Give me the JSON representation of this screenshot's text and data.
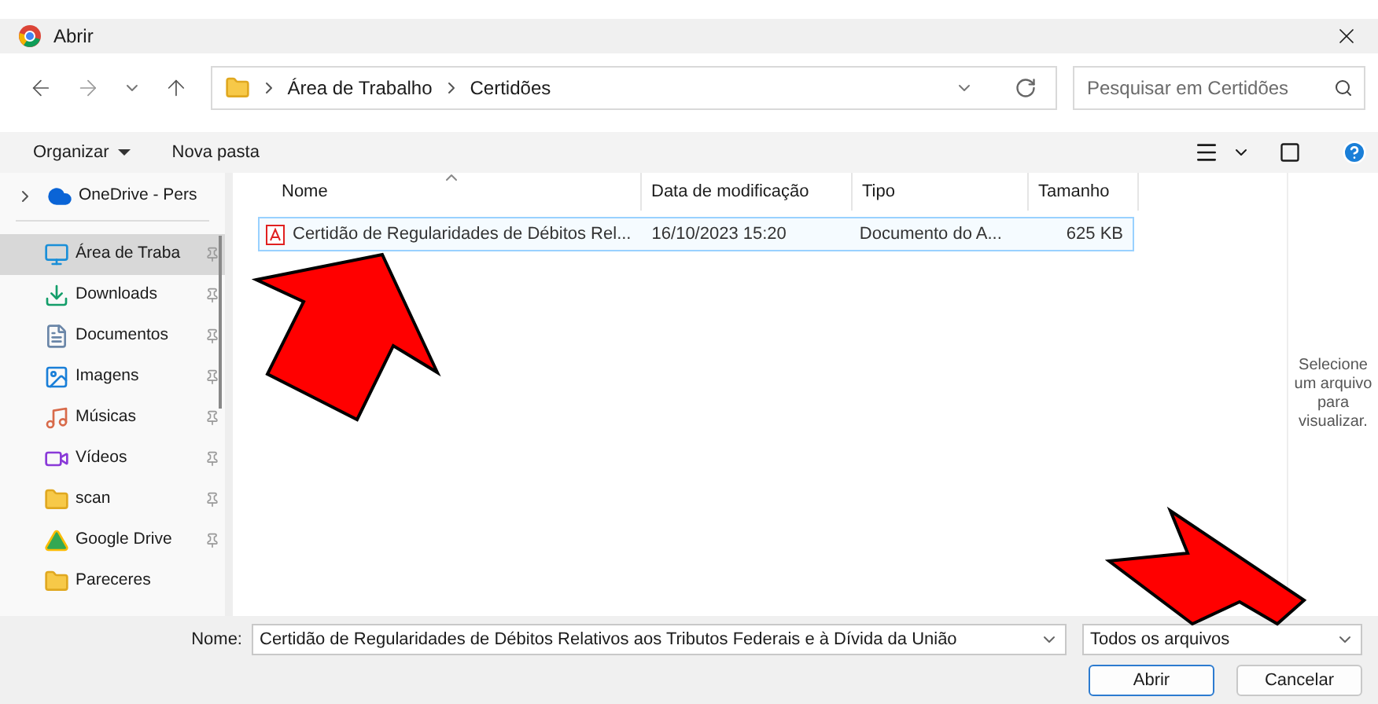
{
  "window": {
    "title": "Abrir"
  },
  "address": {
    "path": [
      "Área de Trabalho",
      "Certidões"
    ]
  },
  "search": {
    "placeholder": "Pesquisar em Certidões"
  },
  "toolbar": {
    "items": [
      "Organizar",
      "Nova pasta"
    ]
  },
  "sidebar": {
    "items": [
      {
        "label": "OneDrive - Pers",
        "kind": "cloud",
        "selected": false,
        "pinned": false
      },
      {
        "label": "Área de Traba",
        "kind": "desktop",
        "selected": true,
        "pinned": true
      },
      {
        "label": "Downloads",
        "kind": "download",
        "selected": false,
        "pinned": true
      },
      {
        "label": "Documentos",
        "kind": "docs",
        "selected": false,
        "pinned": true
      },
      {
        "label": "Imagens",
        "kind": "images",
        "selected": false,
        "pinned": true
      },
      {
        "label": "Músicas",
        "kind": "music",
        "selected": false,
        "pinned": true
      },
      {
        "label": "Vídeos",
        "kind": "video",
        "selected": false,
        "pinned": true
      },
      {
        "label": "scan",
        "kind": "folder",
        "selected": false,
        "pinned": true
      },
      {
        "label": "Google Drive",
        "kind": "drive",
        "selected": false,
        "pinned": true
      },
      {
        "label": "Pareceres",
        "kind": "folder",
        "selected": false,
        "pinned": false
      }
    ]
  },
  "table": {
    "columns": [
      {
        "label": "Nome",
        "sorted": true
      },
      {
        "label": "Data de modificação",
        "sorted": false
      },
      {
        "label": "Tipo",
        "sorted": false
      },
      {
        "label": "Tamanho",
        "sorted": false
      }
    ],
    "rows": [
      {
        "cells": [
          "Certidão de Regularidades de Débitos Rel...",
          "16/10/2023 15:20",
          "Documento do A...",
          "625 KB"
        ],
        "selected": true
      }
    ]
  },
  "preview": {
    "text": "Selecione um arquivo para visualizar."
  },
  "footer": {
    "name_label": "Nome:",
    "name_value": "Certidão de Regularidades de Débitos Relativos aos Tributos Federais e à Dívida da União",
    "file_type": "Todos os arquivos",
    "buttons": [
      {
        "label": "Abrir",
        "default": true
      },
      {
        "label": "Cancelar",
        "default": false
      }
    ]
  }
}
